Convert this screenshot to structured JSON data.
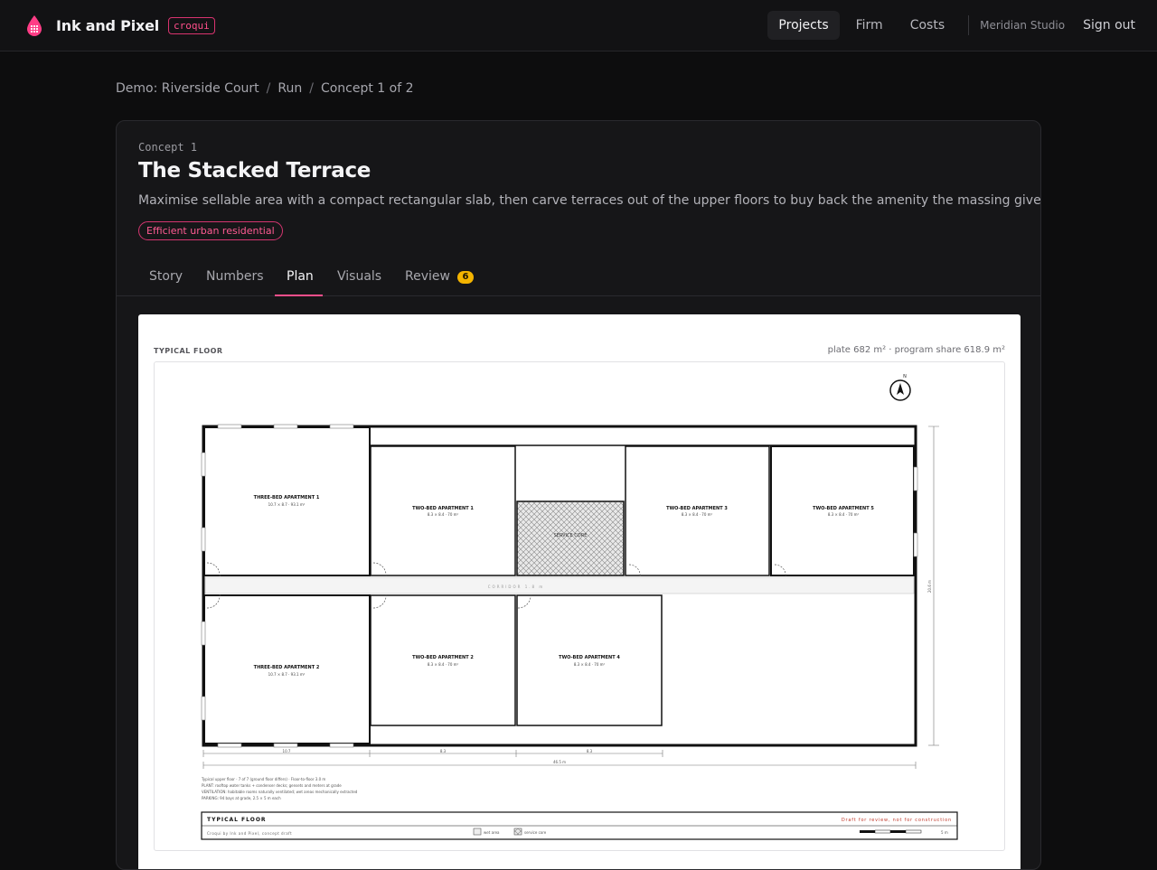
{
  "app": {
    "name": "Ink and Pixel",
    "tag": "croqui",
    "nav": [
      "Projects",
      "Firm",
      "Costs"
    ],
    "org": "Meridian Studio",
    "signout": "Sign out"
  },
  "breadcrumb": [
    "Demo: Riverside Court",
    "Run",
    "Concept 1 of 2"
  ],
  "concept": {
    "kicker": "Concept 1",
    "title": "The Stacked Terrace",
    "description": "Maximise sellable area with a compact rectangular slab, then carve terraces out of the upper floors to buy back the amenity the massing gives up.",
    "tag": "Efficient urban residential"
  },
  "tabs": {
    "items": [
      "Story",
      "Numbers",
      "Plan",
      "Visuals",
      "Review"
    ],
    "review_count": "6",
    "active": "Plan"
  },
  "plan": {
    "heading": "TYPICAL FLOOR",
    "meta": "plate 682 m² · program share 618.9 m²",
    "north": "N",
    "rooms": {
      "three_bed_1": {
        "name": "THREE-BED APARTMENT 1",
        "dims": "10.7 × 8.7 · 93.1 m²"
      },
      "two_bed_1": {
        "name": "TWO-BED APARTMENT 1",
        "dims": "8.3 × 8.4 · 70 m²"
      },
      "service": {
        "name": "SERVICE CORE"
      },
      "two_bed_3": {
        "name": "TWO-BED APARTMENT 3",
        "dims": "8.3 × 8.4 · 70 m²"
      },
      "two_bed_5": {
        "name": "TWO-BED APARTMENT 5",
        "dims": "8.3 × 8.4 · 70 m²"
      },
      "three_bed_2": {
        "name": "THREE-BED APARTMENT 2",
        "dims": "10.7 × 8.7 · 93.1 m²"
      },
      "two_bed_2": {
        "name": "TWO-BED APARTMENT 2",
        "dims": "8.3 × 8.4 · 70 m²"
      },
      "two_bed_4": {
        "name": "TWO-BED APARTMENT 4",
        "dims": "8.3 × 8.4 · 70 m²"
      }
    },
    "corridor": "CORRIDOR 1.8 m",
    "dims": {
      "width": "46.5 m",
      "depth": "20.6 m",
      "seg_1": "10.7",
      "seg_2": "8.3",
      "seg_3": "8.3"
    },
    "notes": [
      "Typical upper floor · 7 of 7 (ground floor differs) · Floor-to-floor 3.0 m",
      "PLANT: rooftop water tanks + condenser decks; gensets and meters at grade",
      "VENTILATION: habitable rooms naturally ventilated; wet areas mechanically extracted",
      "PARKING: 94 bays at grade, 2.5 × 5 m each"
    ],
    "titleblock": {
      "title": "TYPICAL FLOOR",
      "status": "Draft for review, not for construction",
      "credit": "Croqui by Ink and Pixel, concept draft",
      "legend_1": "wet area",
      "legend_2": "service core",
      "scale": "5 m"
    }
  }
}
